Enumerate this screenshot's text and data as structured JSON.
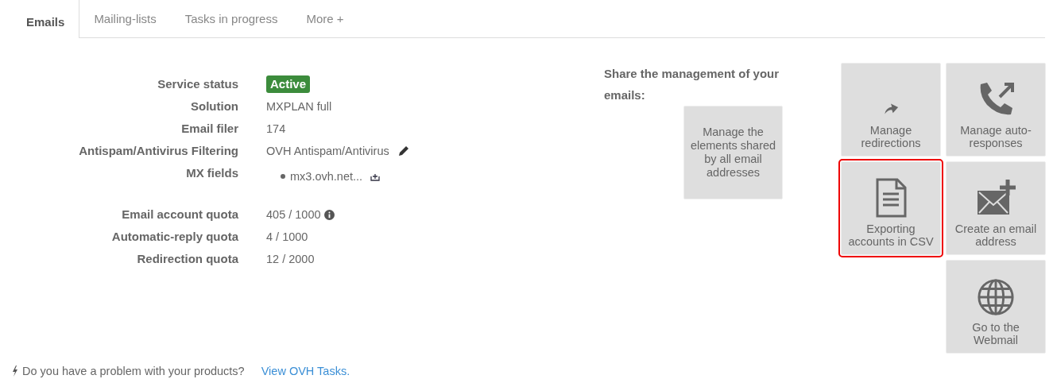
{
  "tabs": [
    {
      "label": "Emails",
      "selected": true
    },
    {
      "label": "Mailing-lists",
      "selected": false
    },
    {
      "label": "Tasks in progress",
      "selected": false
    },
    {
      "label": "More +",
      "selected": false
    }
  ],
  "details": [
    {
      "label": "Service status",
      "kind": "badge",
      "value": "Active"
    },
    {
      "label": "Solution",
      "kind": "text",
      "value": "MXPLAN full"
    },
    {
      "label": "Email filer",
      "kind": "text",
      "value": "174"
    },
    {
      "label": "Antispam/Antivirus Filtering",
      "kind": "edit",
      "value": "OVH Antispam/Antivirus"
    },
    {
      "label": "MX fields",
      "kind": "list",
      "value": "mx3.ovh.net..."
    }
  ],
  "quotas": [
    {
      "label": "Email account quota",
      "value": "405 / 1000",
      "info": true
    },
    {
      "label": "Automatic-reply quota",
      "value": "4 / 1000",
      "info": false
    },
    {
      "label": "Redirection quota",
      "value": "12 / 2000",
      "info": false
    }
  ],
  "share": {
    "title": "Share the management of your emails:",
    "button": "Manage the elements shared by all email addresses"
  },
  "tile_columns": [
    [
      {
        "kind": "redirect",
        "label": "Manage redirections",
        "highlighted": false
      },
      {
        "kind": "document",
        "label": "Exporting accounts in CSV",
        "highlighted": true
      }
    ],
    [
      {
        "kind": "phone",
        "label": "Manage auto-responses",
        "highlighted": false
      },
      {
        "kind": "mail",
        "label": "Create an email address",
        "highlighted": false
      },
      {
        "kind": "globe",
        "label": "Go to the Webmail",
        "highlighted": false
      }
    ]
  ],
  "footer": {
    "text": "Do you have a problem with your products?",
    "link": "View OVH Tasks."
  }
}
